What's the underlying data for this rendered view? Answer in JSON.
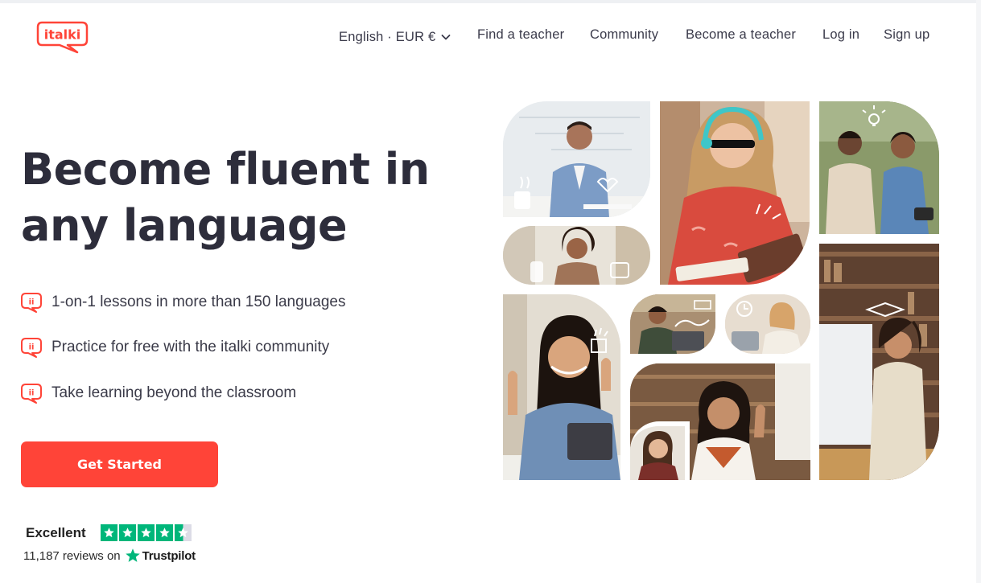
{
  "brand": {
    "logo_text": "italki",
    "accent": "#ff4438"
  },
  "nav": {
    "language_currency": "English · EUR €",
    "find_teacher": "Find a teacher",
    "community": "Community",
    "become_teacher": "Become a teacher",
    "login": "Log in",
    "signup": "Sign up"
  },
  "hero": {
    "title_line1": "Become fluent in",
    "title_line2": "any language",
    "features": [
      {
        "icon": "italki-bubble-icon",
        "text": "1-on-1 lessons in more than 150 languages"
      },
      {
        "icon": "italki-bubble-icon",
        "text": "Practice for free with the italki community"
      },
      {
        "icon": "italki-bubble-icon",
        "text": "Take learning beyond the classroom"
      }
    ],
    "cta_label": "Get Started"
  },
  "trustpilot": {
    "rating_label": "Excellent",
    "stars": 4.5,
    "reviews_prefix": "11,187 reviews on",
    "brand_name": "Trustpilot",
    "star_color": "#00b67a"
  },
  "collage": {
    "photos": [
      "man-at-whiteboard-photo",
      "woman-with-headphones-photo",
      "two-men-outdoors-photo",
      "woman-at-desk-photo",
      "woman-waving-at-tablet-photo",
      "man-laptop-photo",
      "woman-clock-photo",
      "woman-in-library-photo",
      "woman-waving-photo",
      "woman-small-photo",
      "woman-bookshelf-photo"
    ]
  }
}
